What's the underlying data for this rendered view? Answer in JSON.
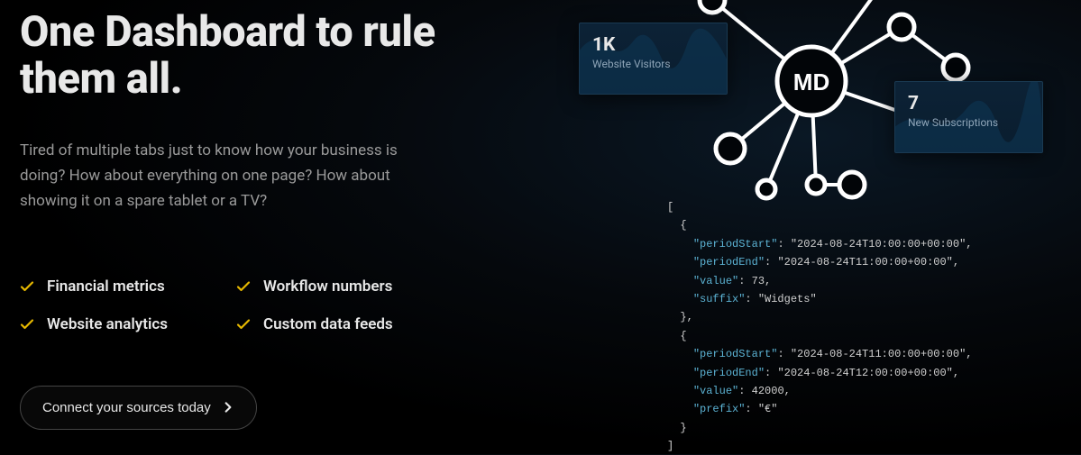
{
  "hero": {
    "title": "One Dashboard to rule them all.",
    "description": "Tired of multiple tabs just to know how your business is doing? How about everything on one page? How about showing it on a spare tablet or a TV?"
  },
  "features": [
    "Financial metrics",
    "Workflow numbers",
    "Website analytics",
    "Custom data feeds"
  ],
  "cta": {
    "label": "Connect your sources today"
  },
  "stats": {
    "visitors": {
      "value": "1K",
      "label": "Website Visitors"
    },
    "subs": {
      "value": "7",
      "label": "New Subscriptions"
    }
  },
  "logo": "MD",
  "code": {
    "items": [
      {
        "periodStart": "2024-08-24T10:00:00+00:00",
        "periodEnd": "2024-08-24T11:00:00+00:00",
        "value": "73",
        "extraKey": "suffix",
        "extraVal": "Widgets"
      },
      {
        "periodStart": "2024-08-24T11:00:00+00:00",
        "periodEnd": "2024-08-24T12:00:00+00:00",
        "value": "42000",
        "extraKey": "prefix",
        "extraVal": "€"
      }
    ]
  }
}
